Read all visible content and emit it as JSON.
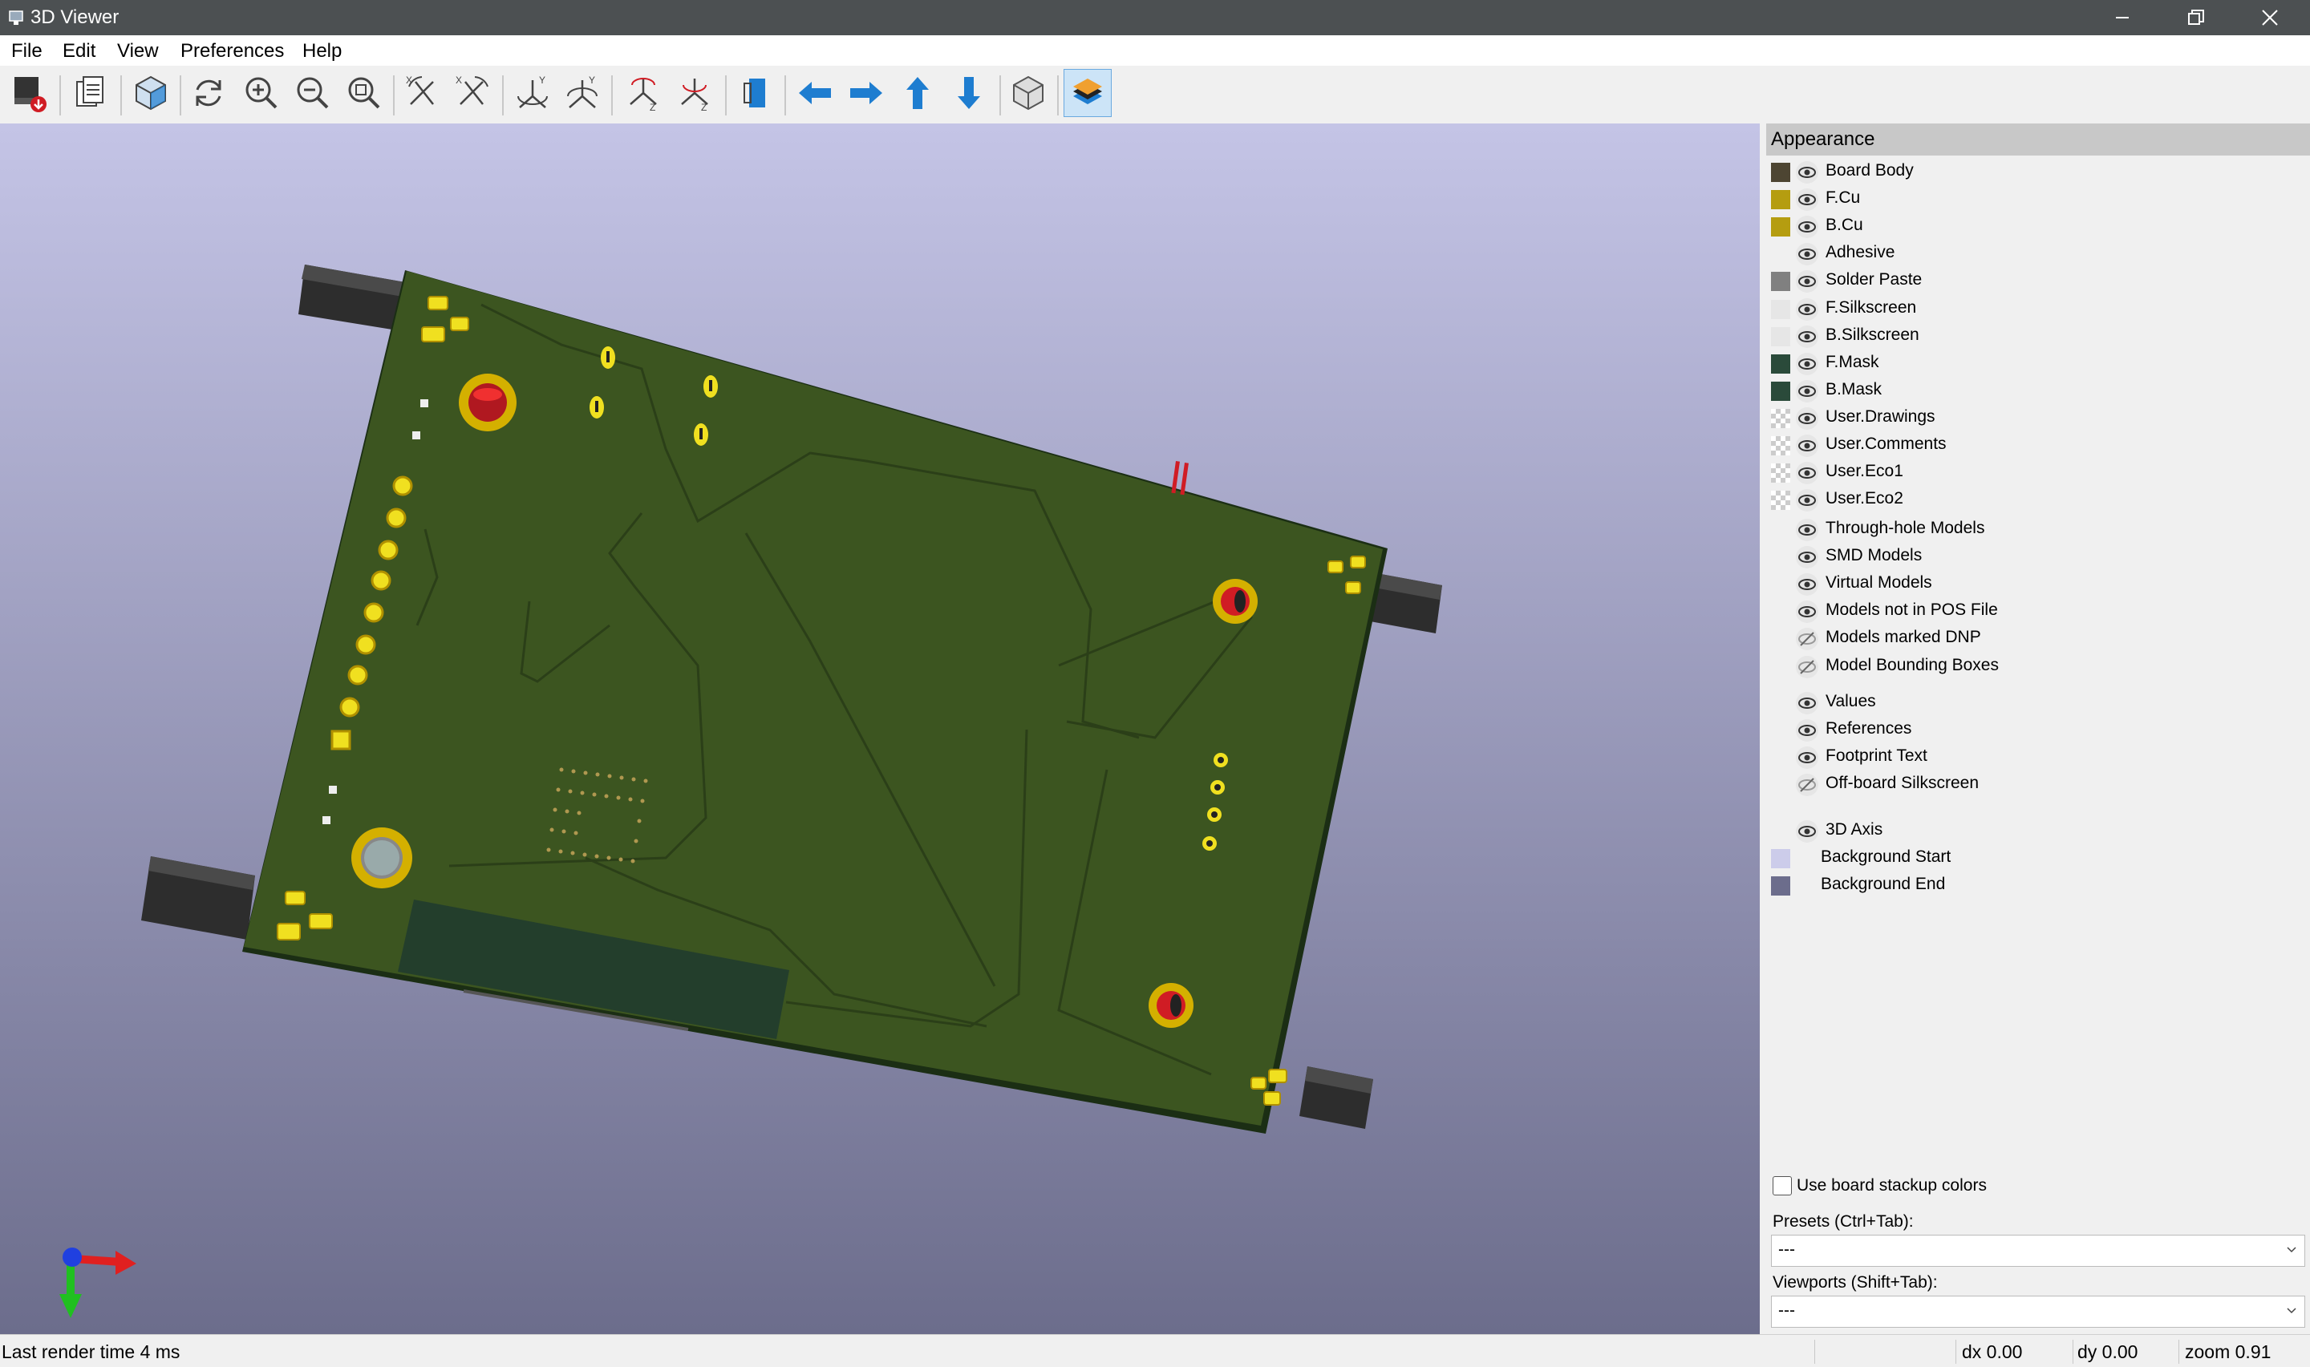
{
  "window": {
    "title": "3D Viewer"
  },
  "menu": {
    "items": [
      "File",
      "Edit",
      "View",
      "Preferences",
      "Help"
    ]
  },
  "toolbar": {
    "buttons": [
      "export-image-icon",
      "copy-image-icon",
      "render-mode-icon",
      "reload-board-icon",
      "zoom-in-icon",
      "zoom-out-icon",
      "zoom-fit-icon",
      "rotate-x-cw-icon",
      "rotate-x-ccw-icon",
      "rotate-y-cw-icon",
      "rotate-y-ccw-icon",
      "rotate-z-cw-icon",
      "rotate-z-ccw-icon",
      "flip-board-icon",
      "move-left-icon",
      "move-right-icon",
      "move-up-icon",
      "move-down-icon",
      "orthographic-icon",
      "appearance-panel-icon"
    ],
    "accent": "#0a78d4"
  },
  "panel": {
    "title": "Appearance",
    "layers": [
      {
        "label": "Board Body",
        "color": "#4d4532",
        "visible": true
      },
      {
        "label": "F.Cu",
        "color": "#b59d10",
        "visible": true
      },
      {
        "label": "B.Cu",
        "color": "#b59d10",
        "visible": true
      },
      {
        "label": "Adhesive",
        "color": "",
        "visible": true
      },
      {
        "label": "Solder Paste",
        "color": "#808080",
        "visible": true
      },
      {
        "label": "F.Silkscreen",
        "color": "#e6e6e6",
        "visible": true
      },
      {
        "label": "B.Silkscreen",
        "color": "#e6e6e6",
        "visible": true
      },
      {
        "label": "F.Mask",
        "color": "#2a4a3a",
        "visible": true
      },
      {
        "label": "B.Mask",
        "color": "#2a4a3a",
        "visible": true
      },
      {
        "label": "User.Drawings",
        "color": "checker",
        "visible": true
      },
      {
        "label": "User.Comments",
        "color": "checker",
        "visible": true
      },
      {
        "label": "User.Eco1",
        "color": "checker",
        "visible": true
      },
      {
        "label": "User.Eco2",
        "color": "checker",
        "visible": true
      }
    ],
    "models": [
      {
        "label": "Through-hole Models",
        "visible": true
      },
      {
        "label": "SMD Models",
        "visible": true
      },
      {
        "label": "Virtual Models",
        "visible": true
      },
      {
        "label": "Models not in POS File",
        "visible": true
      },
      {
        "label": "Models marked DNP",
        "visible": false
      },
      {
        "label": "Model Bounding Boxes",
        "visible": false
      }
    ],
    "text_items": [
      {
        "label": "Values",
        "visible": true
      },
      {
        "label": "References",
        "visible": true
      },
      {
        "label": "Footprint Text",
        "visible": true
      },
      {
        "label": "Off-board Silkscreen",
        "visible": false
      }
    ],
    "axis": {
      "label": "3D Axis",
      "visible": true
    },
    "backgrounds": [
      {
        "label": "Background Start",
        "color": "#ccccea"
      },
      {
        "label": "Background End",
        "color": "#6c6d8c"
      }
    ],
    "stackup_label": "Use board stackup colors",
    "presets_label": "Presets (Ctrl+Tab):",
    "presets_value": "---",
    "viewports_label": "Viewports (Shift+Tab):",
    "viewports_value": "---"
  },
  "status": {
    "render": "Last render time 4 ms",
    "dx": "dx 0.00",
    "dy": "dy 0.00",
    "zoom": "zoom 0.91"
  }
}
